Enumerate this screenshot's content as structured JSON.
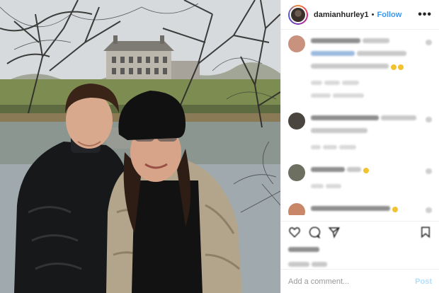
{
  "post_header": {
    "username": "damianhurley1",
    "separator": "•",
    "follow_label": "Follow",
    "more_icon": "more-dots-icon",
    "avatar_icon": "profile-avatar-icon"
  },
  "photo": {
    "icon": "post-photo"
  },
  "comments": [
    {
      "avatar_color": "#c8927e"
    },
    {
      "avatar_color": "#4b4540"
    },
    {
      "avatar_color": "#6d7060"
    },
    {
      "avatar_color": "#c9876a"
    }
  ],
  "actions": {
    "like_icon": "heart-icon",
    "comment_icon": "comment-icon",
    "share_icon": "share-icon",
    "save_icon": "bookmark-icon"
  },
  "add_comment": {
    "placeholder": "Add a comment...",
    "post_label": "Post"
  },
  "colors": {
    "accent": "#3897f0",
    "post_disabled": "#b2dffc",
    "divider": "#efefef"
  }
}
